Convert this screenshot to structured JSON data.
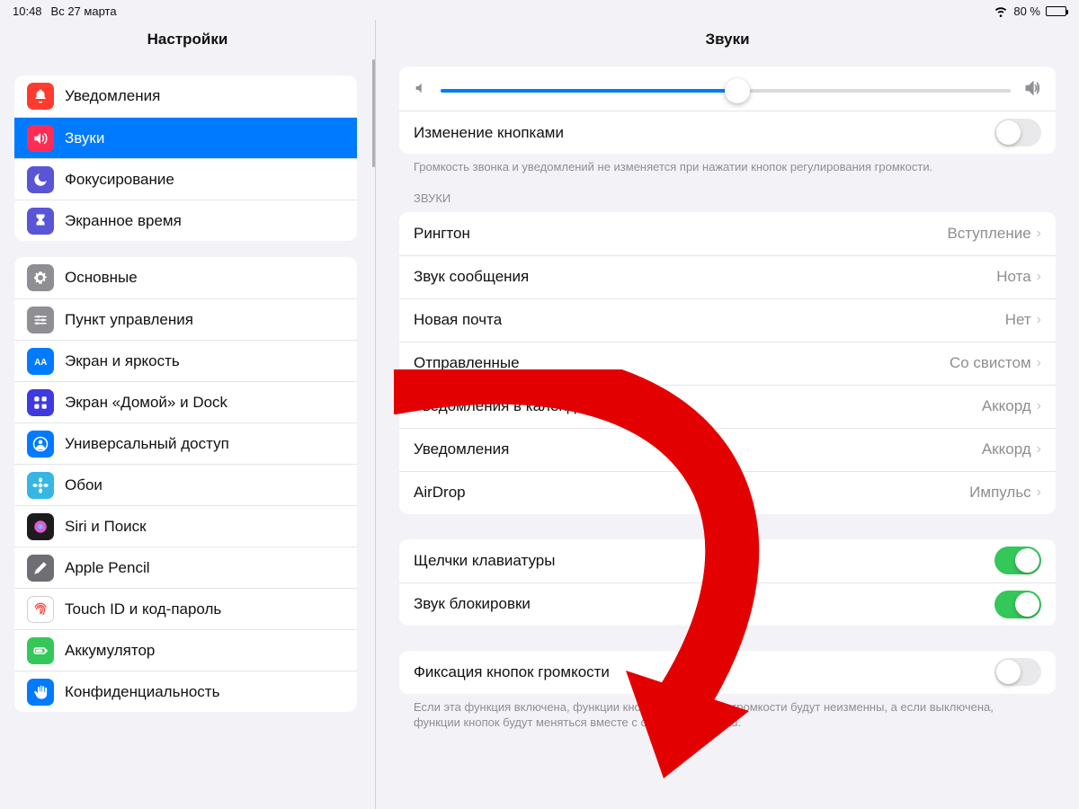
{
  "status": {
    "time": "10:48",
    "date": "Вс 27 марта",
    "battery_pct": "80 %",
    "battery_fill": 80
  },
  "sidebar": {
    "title": "Настройки",
    "group1": [
      {
        "label": "Уведомления",
        "icon_bg": "#ff3b30",
        "icon": "bell"
      },
      {
        "label": "Звуки",
        "icon_bg": "#ff2d55",
        "icon": "speaker",
        "selected": true
      },
      {
        "label": "Фокусирование",
        "icon_bg": "#5856d6",
        "icon": "moon"
      },
      {
        "label": "Экранное время",
        "icon_bg": "#5856d6",
        "icon": "hourglass"
      }
    ],
    "group2": [
      {
        "label": "Основные",
        "icon_bg": "#8e8e93",
        "icon": "gear"
      },
      {
        "label": "Пункт управления",
        "icon_bg": "#8e8e93",
        "icon": "sliders"
      },
      {
        "label": "Экран и яркость",
        "icon_bg": "#007aff",
        "icon": "aa"
      },
      {
        "label": "Экран «Домой» и Dock",
        "icon_bg": "#3f3ae0",
        "icon": "grid"
      },
      {
        "label": "Универсальный доступ",
        "icon_bg": "#007aff",
        "icon": "person"
      },
      {
        "label": "Обои",
        "icon_bg": "#36b7e3",
        "icon": "flower"
      },
      {
        "label": "Siri и Поиск",
        "icon_bg": "#1c1c1e",
        "icon": "siri"
      },
      {
        "label": "Apple Pencil",
        "icon_bg": "#6e6e73",
        "icon": "pencil"
      },
      {
        "label": "Touch ID и код-пароль",
        "icon_bg": "#ffffff",
        "icon": "fingerprint",
        "icon_fg": "#ff3b30",
        "bordered": true
      },
      {
        "label": "Аккумулятор",
        "icon_bg": "#34c759",
        "icon": "battery"
      },
      {
        "label": "Конфиденциальность",
        "icon_bg": "#007aff",
        "icon": "hand"
      }
    ]
  },
  "panel": {
    "title": "Звуки",
    "volume_pct": 52,
    "change_with_buttons_label": "Изменение кнопками",
    "change_with_buttons_on": false,
    "volume_footer": "Громкость звонка и уведомлений не изменяется при нажатии кнопок регулирования громкости.",
    "sounds_header": "ЗВУКИ",
    "sounds": [
      {
        "label": "Рингтон",
        "value": "Вступление"
      },
      {
        "label": "Звук сообщения",
        "value": "Нота"
      },
      {
        "label": "Новая почта",
        "value": "Нет"
      },
      {
        "label": "Отправленные",
        "value": "Со свистом"
      },
      {
        "label": "Уведомления в календарях",
        "value": "Аккорд"
      },
      {
        "label": "Уведомления",
        "value": "Аккорд"
      },
      {
        "label": "AirDrop",
        "value": "Импульс"
      }
    ],
    "toggles": [
      {
        "label": "Щелчки клавиатуры",
        "on": true
      },
      {
        "label": "Звук блокировки",
        "on": true
      }
    ],
    "lock_label": "Фиксация кнопок громкости",
    "lock_on": false,
    "lock_footer": "Если эта функция включена, функции кнопок регулировки громкости будут неизменны, а если выключена, функции кнопок будут меняться вместе с ориентацией iPad."
  }
}
